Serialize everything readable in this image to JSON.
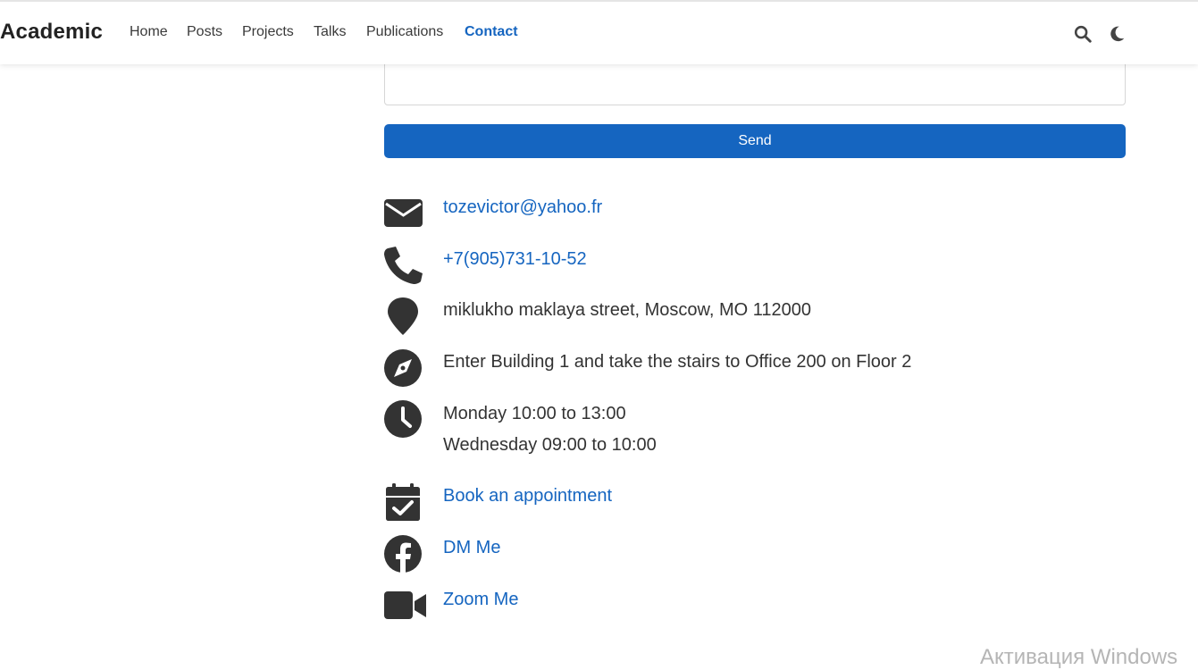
{
  "navbar": {
    "brand": "Academic",
    "links": [
      {
        "label": "Home"
      },
      {
        "label": "Posts"
      },
      {
        "label": "Projects"
      },
      {
        "label": "Talks"
      },
      {
        "label": "Publications"
      },
      {
        "label": "Contact",
        "active": true
      }
    ],
    "icons": [
      "search-icon",
      "moon-icon"
    ]
  },
  "form": {
    "message_value": "",
    "send_label": "Send"
  },
  "contact": {
    "email": "tozevictor@yahoo.fr",
    "phone": "+7(905)731-10-52",
    "address": "miklukho maklaya street, Moscow, MO 112000",
    "directions": "Enter Building 1 and take the stairs to Office 200 on Floor 2",
    "office_hours": [
      "Monday 10:00 to 13:00",
      "Wednesday 09:00 to 10:00"
    ],
    "appointment": "Book an appointment",
    "dm": "DM Me",
    "zoom": "Zoom Me"
  },
  "overlay": {
    "watermark": "Активация Windows"
  },
  "colors": {
    "accent": "#1565c0",
    "icon": "#333333",
    "text": "#333333"
  }
}
